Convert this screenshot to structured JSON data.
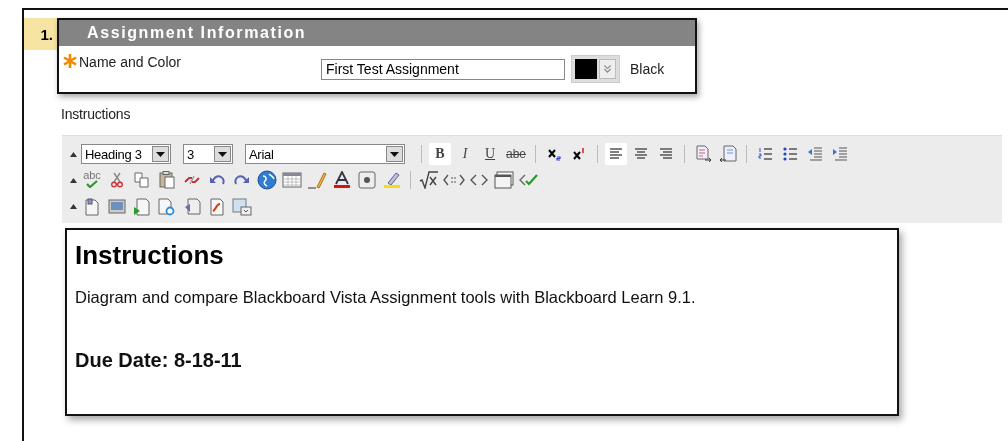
{
  "step": {
    "number": "1."
  },
  "section": {
    "title": "Assignment Information"
  },
  "name_field": {
    "required": true,
    "label": "Name and Color",
    "value": "First Test Assignment",
    "color": "#000000",
    "color_name": "Black"
  },
  "instructions": {
    "label": "Instructions"
  },
  "editor": {
    "toolbar": {
      "rows": [
        {
          "items": [
            {
              "kind": "collapse"
            },
            {
              "kind": "select",
              "value": "Heading 3"
            },
            {
              "kind": "select",
              "value": "3"
            },
            {
              "kind": "select",
              "value": "Arial"
            },
            {
              "kind": "separator"
            },
            {
              "kind": "bold",
              "label": "B",
              "on": true
            },
            {
              "kind": "italic",
              "label": "I",
              "on": false
            },
            {
              "kind": "underline",
              "label": "U",
              "on": false
            },
            {
              "kind": "strike",
              "label": "abe",
              "on": false
            },
            {
              "kind": "separator"
            },
            {
              "kind": "subscript",
              "on": false
            },
            {
              "kind": "superscript",
              "on": false
            },
            {
              "kind": "separator"
            },
            {
              "kind": "align-left",
              "on": true
            },
            {
              "kind": "align-center",
              "on": false
            },
            {
              "kind": "align-right",
              "on": false
            },
            {
              "kind": "separator"
            },
            {
              "kind": "doc-right"
            },
            {
              "kind": "doc-left"
            },
            {
              "kind": "separator"
            },
            {
              "kind": "numbered-list"
            },
            {
              "kind": "bullet-list"
            },
            {
              "kind": "outdent"
            },
            {
              "kind": "indent"
            }
          ]
        },
        {
          "items": [
            {
              "kind": "collapse"
            },
            {
              "kind": "spellcheck",
              "label": "abc"
            },
            {
              "kind": "cut"
            },
            {
              "kind": "copy"
            },
            {
              "kind": "paste"
            },
            {
              "kind": "unlink"
            },
            {
              "kind": "undo"
            },
            {
              "kind": "redo"
            },
            {
              "kind": "globe"
            },
            {
              "kind": "table"
            },
            {
              "kind": "pencil"
            },
            {
              "kind": "font-color"
            },
            {
              "kind": "box"
            },
            {
              "kind": "highlight"
            },
            {
              "kind": "separator"
            },
            {
              "kind": "sqrt"
            },
            {
              "kind": "code-arrows"
            },
            {
              "kind": "code"
            },
            {
              "kind": "window"
            },
            {
              "kind": "check-code"
            }
          ]
        },
        {
          "items": [
            {
              "kind": "collapse"
            },
            {
              "kind": "doc"
            },
            {
              "kind": "image"
            },
            {
              "kind": "media"
            },
            {
              "kind": "doc-search"
            },
            {
              "kind": "doc-audio"
            },
            {
              "kind": "doc-flash"
            },
            {
              "kind": "gallery"
            }
          ]
        }
      ]
    },
    "content": {
      "heading": "Instructions",
      "paragraph": "Diagram and compare Blackboard Vista Assignment tools with Blackboard Learn 9.1.",
      "due": "Due Date: 8-18-11"
    }
  }
}
